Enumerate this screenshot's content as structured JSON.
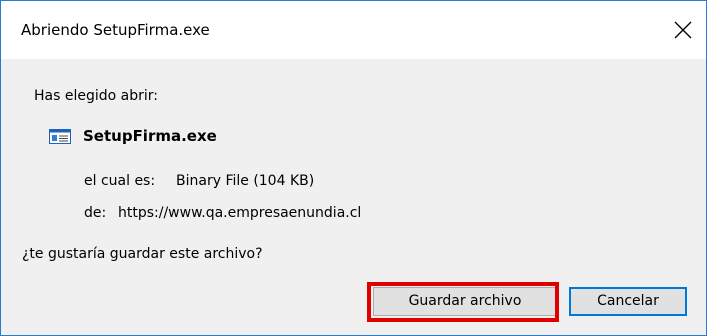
{
  "dialog": {
    "title": "Abriendo SetupFirma.exe",
    "prompt": "Has elegido abrir:",
    "file_name": "SetupFirma.exe",
    "type_label": "el cual es:",
    "type_value": "Binary File (104 KB)",
    "from_label": "de:",
    "from_value": "https://www.qa.empresaenundia.cl",
    "question": "¿te gustaría guardar este archivo?",
    "save_label": "Guardar archivo",
    "cancel_label": "Cancelar",
    "icons": {
      "close": "close-icon",
      "file": "executable-file-icon"
    },
    "colors": {
      "window_border": "#2b79d7",
      "highlight": "#e00000",
      "default_button_border": "#0078d7"
    }
  }
}
